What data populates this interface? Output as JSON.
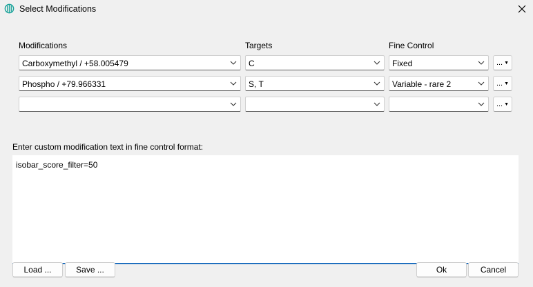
{
  "window": {
    "title": "Select Modifications",
    "icon": "app-logo-icon",
    "close_icon": "close-icon"
  },
  "columns": {
    "modifications": "Modifications",
    "targets": "Targets",
    "fine_control": "Fine Control"
  },
  "rows": [
    {
      "modification": "Carboxymethyl / +58.005479",
      "targets": "C",
      "fine_control": "Fixed",
      "menu_label": "..."
    },
    {
      "modification": "Phospho / +79.966331",
      "targets": "S, T",
      "fine_control": "Variable - rare 2",
      "menu_label": "..."
    },
    {
      "modification": "",
      "targets": "",
      "fine_control": "",
      "menu_label": "..."
    }
  ],
  "custom": {
    "label": "Enter custom modification text in fine control format:",
    "value": "isobar_score_filter=50"
  },
  "buttons": {
    "load": "Load ...",
    "save": "Save ...",
    "ok": "Ok",
    "cancel": "Cancel"
  },
  "colors": {
    "accent": "#1f6fbf",
    "window_bg": "#f0f0f0",
    "logo": "#1aa39a"
  }
}
